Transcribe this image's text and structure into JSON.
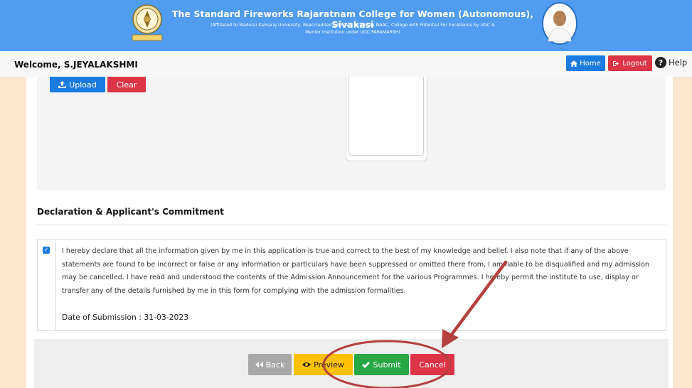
{
  "header": {
    "title": "The Standard Fireworks Rajaratnam College for Women (Autonomous), Sivakasi",
    "subtitle_line1": "(Affiliated to Madurai Kamaraj University, Reaccredited with 'A+' Grade by NAAC, College with Potential For Excellence by UGC &",
    "subtitle_line2": "Mentor Institution under UGC PARAMARSH)",
    "bg_color": "#4f9cf0"
  },
  "navbar": {
    "welcome": "Welcome, S.JEYALAKSHMI",
    "home_label": "Home",
    "logout_label": "Logout",
    "help_label": "Help",
    "home_icon": "home-icon",
    "logout_icon": "logout-icon",
    "help_icon": "question-circle-icon"
  },
  "upload": {
    "upload_label": "Upload",
    "clear_label": "Clear",
    "upload_icon": "upload-icon"
  },
  "declaration": {
    "title": "Declaration & Applicant's Commitment",
    "checked": true,
    "text": "I hereby declare that all the information given by me in this application is true and correct to the best of my knowledge and belief. I also note that if any of the above statements are found to be incorrect or false or any information or particulars have been suppressed or omitted there from, I am liable to be disqualified and my admission may be cancelled. I have read and understood the contents of the Admission Announcement for the various Programmes. I hereby permit the institute to use, display or transfer any of the details furnished by me in this form for complying with the admission formalities.",
    "date_label": "Date of Submission : 31-03-2023"
  },
  "actions": {
    "back_label": "Back",
    "preview_label": "Preview",
    "submit_label": "Submit",
    "cancel_label": "Cancel",
    "back_icon": "backward-icon",
    "preview_icon": "eye-icon",
    "submit_icon": "check-icon"
  },
  "colors": {
    "primary": "#1a7be0",
    "danger": "#dc3545",
    "warning": "#ffc107",
    "success": "#28a745",
    "secondary": "#a8a8a8",
    "annotation": "#b5403e"
  }
}
